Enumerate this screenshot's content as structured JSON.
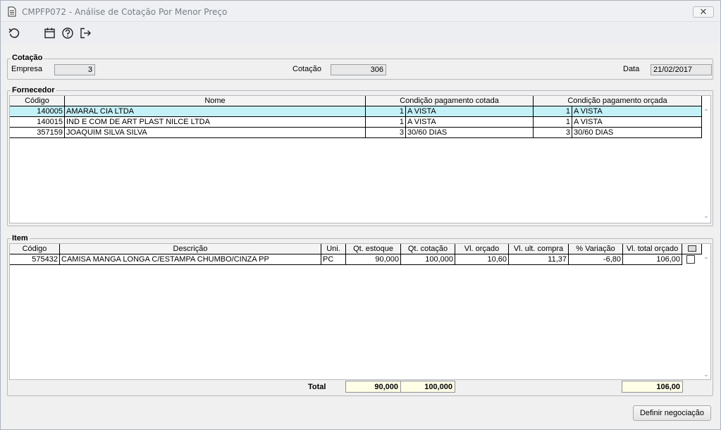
{
  "window": {
    "title": "CMPFP072 - Análise de Cotação Por Menor Preço",
    "close_label": "✕"
  },
  "toolbar": {
    "icons": [
      "refresh-icon",
      "calendar-icon",
      "help-icon",
      "exit-icon"
    ]
  },
  "cotacao": {
    "legend": "Cotação",
    "empresa_label": "Empresa",
    "empresa_value": "3",
    "cotacao_label": "Cotação",
    "cotacao_value": "306",
    "data_label": "Data",
    "data_value": "21/02/2017"
  },
  "fornecedor": {
    "legend": "Fornecedor",
    "columns": [
      "Código",
      "Nome",
      "Condição pagamento cotada",
      "Condição pagamento orçada"
    ],
    "rows": [
      {
        "codigo": "140005",
        "nome": "AMARAL CIA LTDA",
        "cot_num": "1",
        "cot_desc": "A VISTA",
        "orc_num": "1",
        "orc_desc": "A VISTA",
        "selected": true
      },
      {
        "codigo": "140015",
        "nome": "IND E COM DE ART PLAST NILCE LTDA",
        "cot_num": "1",
        "cot_desc": "A VISTA",
        "orc_num": "1",
        "orc_desc": "A VISTA",
        "selected": false
      },
      {
        "codigo": "357159",
        "nome": "JOAQUIM SILVA SILVA",
        "cot_num": "3",
        "cot_desc": "30/60 DIAS",
        "orc_num": "3",
        "orc_desc": "30/60 DIAS",
        "selected": false
      }
    ]
  },
  "item": {
    "legend": "Item",
    "columns": [
      "Código",
      "Descrição",
      "Uni.",
      "Qt. estoque",
      "Qt. cotação",
      "Vl. orçado",
      "Vl. ult. compra",
      "% Variação",
      "Vl. total orçado"
    ],
    "rows": [
      {
        "codigo": "575432",
        "descricao": "CAMISA MANGA LONGA C/ESTAMPA CHUMBO/CINZA PP",
        "uni": "PC",
        "qt_estoque": "90,000",
        "qt_cotacao": "100,000",
        "vl_orcado": "10,60",
        "vl_ult_compra": "11,37",
        "variacao": "-6,80",
        "vl_total_orcado": "106,00",
        "checked": false
      }
    ],
    "total_label": "Total",
    "total_qt_estoque": "90,000",
    "total_qt_cotacao": "100,000",
    "total_vl_total": "106,00"
  },
  "footer": {
    "definir_label": "Definir negociação"
  }
}
